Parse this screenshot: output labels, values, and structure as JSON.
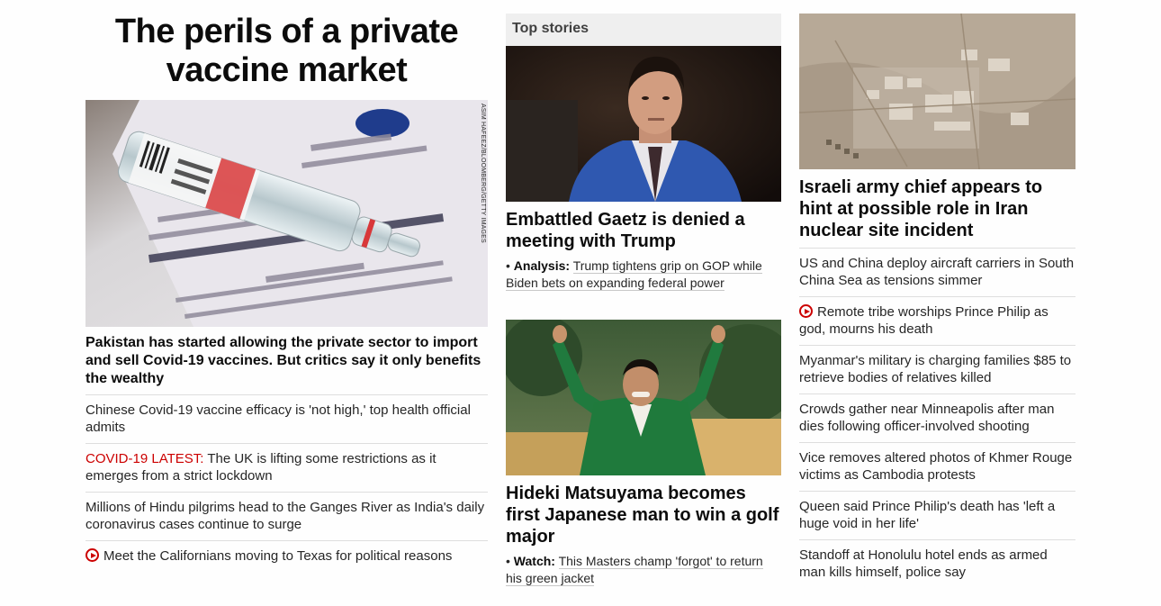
{
  "col1": {
    "zone_headline": "The perils of a private vaccine market",
    "hero_credit": "ASIM HAFEEZ/BLOOMBERG/GETTY IMAGES",
    "hero_headline": "Pakistan has started allowing the private sector to import and sell Covid-19 vaccines. But critics say it only benefits the wealthy",
    "items": [
      {
        "prefix": "",
        "text": "Chinese Covid-19 vaccine efficacy is 'not high,' top health official admits"
      },
      {
        "prefix": "COVID-19 LATEST:",
        "text": " The UK is lifting some restrictions as it emerges from a strict lockdown"
      },
      {
        "prefix": "",
        "text": "Millions of Hindu pilgrims head to the Ganges River as India's daily coronavirus cases continue to surge"
      },
      {
        "prefix": "",
        "text": "Meet the Californians moving to Texas for political reasons",
        "video": true
      }
    ]
  },
  "col2": {
    "section_label": "Top stories",
    "story1": {
      "headline": "Embattled Gaetz is denied a meeting with Trump",
      "sub_label": "Analysis:",
      "sub_text": "Trump tightens grip on GOP while Biden bets on expanding federal power"
    },
    "story2": {
      "headline": "Hideki Matsuyama becomes first Japanese man to win a golf major",
      "sub_label": "Watch:",
      "sub_text": "This Masters champ 'forgot' to return his green jacket"
    }
  },
  "col3": {
    "headline": "Israeli army chief appears to hint at possible role in Iran nuclear site incident",
    "items": [
      {
        "text": "US and China deploy aircraft carriers in South China Sea as tensions simmer"
      },
      {
        "text": "Remote tribe worships Prince Philip as god, mourns his death",
        "video": true
      },
      {
        "text": "Myanmar's military is charging families $85 to retrieve bodies of relatives killed"
      },
      {
        "text": "Crowds gather near Minneapolis after man dies following officer-involved shooting"
      },
      {
        "text": "Vice removes altered photos of Khmer Rouge victims as Cambodia protests"
      },
      {
        "text": "Queen said Prince Philip's death has 'left a huge void in her life'"
      },
      {
        "text": "Standoff at Honolulu hotel ends as armed man kills himself, police say"
      }
    ]
  },
  "colors": {
    "accent_red": "#cc0000",
    "divider": "#dedede",
    "label_bg": "#efefef"
  }
}
